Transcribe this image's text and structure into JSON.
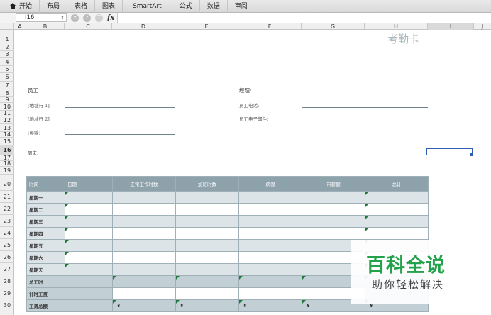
{
  "ribbon": {
    "tabs": [
      "开始",
      "布局",
      "表格",
      "图表",
      "SmartArt",
      "公式",
      "数据",
      "审阅"
    ]
  },
  "formula_bar": {
    "name_box": "I16",
    "fx_label": "fx",
    "formula": ""
  },
  "columns": [
    "A",
    "B",
    "C",
    "D",
    "E",
    "F",
    "G",
    "H",
    "I",
    "J"
  ],
  "rows": [
    "1",
    "2",
    "3",
    "4",
    "5",
    "6",
    "7",
    "8",
    "9",
    "10",
    "11",
    "12",
    "13",
    "14",
    "15",
    "16",
    "17",
    "18",
    "19",
    "20",
    "21",
    "22",
    "23",
    "24",
    "25",
    "26",
    "27",
    "28",
    "29",
    "30"
  ],
  "selected_cell": {
    "column": "I",
    "row": "16"
  },
  "sheet": {
    "title": "考勤卡",
    "employee_label": "员工",
    "address1_label": "[地址行 1]",
    "address2_label": "[地址行 2]",
    "zip_label": "[邮编]",
    "week_end_label": "周末:",
    "manager_label": "经理:",
    "phone_label": "员工电话:",
    "email_label": "员工电子邮件:"
  },
  "timesheet": {
    "headers": [
      "时间",
      "日期",
      "正常工作时数",
      "加班时数",
      "病假",
      "带薪假",
      "总计"
    ],
    "days": [
      "星期一",
      "星期二",
      "星期三",
      "星期四",
      "星期五",
      "星期六",
      "星期天"
    ],
    "total_hours_label": "总工时",
    "hourly_rate_label": "计时工资",
    "total_pay_label": "工资总额",
    "currency_symbol": "¥",
    "dash": "-"
  },
  "watermark": {
    "title": "百科全说",
    "subtitle": "助你轻松解决"
  }
}
